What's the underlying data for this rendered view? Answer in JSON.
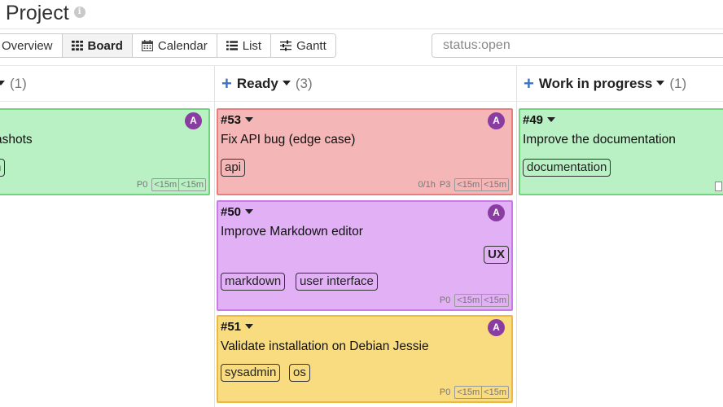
{
  "project": {
    "title": "o Project",
    "info_icon": "i"
  },
  "views": {
    "overview": "Overview",
    "board": "Board",
    "calendar": "Calendar",
    "list": "List",
    "gantt": "Gantt"
  },
  "search": {
    "value": "",
    "placeholder": "status:open"
  },
  "columns": [
    {
      "name": "",
      "count": "(1)"
    },
    {
      "name": "Ready",
      "count": "(3)"
    },
    {
      "name": "Work in progress",
      "count": "(1)"
    }
  ],
  "cards": {
    "c0": {
      "title": "ashots",
      "avatar": "A",
      "labels": [
        "n"
      ],
      "priority": "P0",
      "est": [
        "<15m",
        "<15m"
      ]
    },
    "c53": {
      "number": "#53",
      "title": "Fix API bug (edge case)",
      "avatar": "A",
      "labels": [
        "api"
      ],
      "time": "0/1h",
      "priority": "P3",
      "est": [
        "<15m",
        "<15m"
      ]
    },
    "c50": {
      "number": "#50",
      "title": "Improve Markdown editor",
      "avatar": "A",
      "tag": "UX",
      "labels": [
        "markdown",
        "user interface"
      ],
      "priority": "P0",
      "est": [
        "<15m",
        "<15m"
      ]
    },
    "c51": {
      "number": "#51",
      "title": "Validate installation on Debian Jessie",
      "avatar": "A",
      "labels": [
        "sysadmin",
        "os"
      ],
      "priority": "P0",
      "est": [
        "<15m",
        "<15m"
      ]
    },
    "c49": {
      "number": "#49",
      "title": "Improve the documentation",
      "avatar": "A",
      "labels": [
        "documentation"
      ]
    }
  },
  "colors": {
    "accent": "#3b73c8",
    "avatar": "#8b3ca3",
    "green": "#b9f0c4",
    "red": "#f4b6b6",
    "purple": "#e1b0f5",
    "yellow": "#f9dc80"
  },
  "icons": {
    "board": "grid-icon",
    "calendar": "calendar-icon",
    "list": "list-icon",
    "gantt": "sliders-icon",
    "add": "plus-icon"
  }
}
